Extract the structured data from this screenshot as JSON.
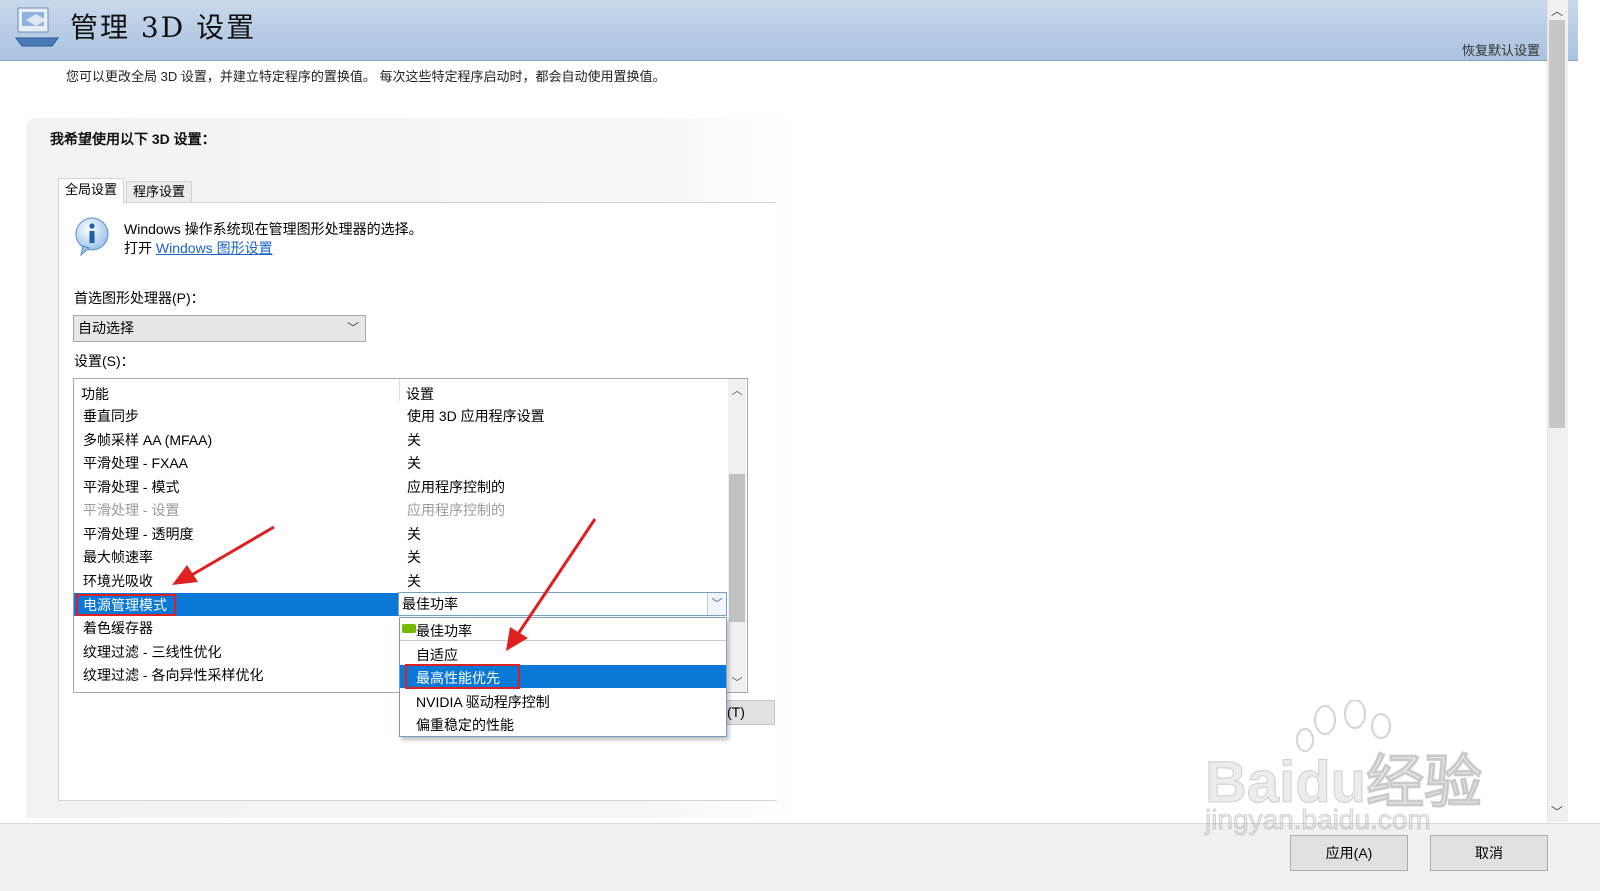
{
  "header": {
    "title": "管理 3D 设置",
    "restore_defaults": "恢复默认设置"
  },
  "description": "您可以更改全局 3D 设置，并建立特定程序的置换值。 每次这些特定程序启动时，都会自动使用置换值。",
  "panel": {
    "heading": "我希望使用以下 3D 设置：",
    "tabs": [
      "全局设置",
      "程序设置"
    ],
    "info_line1": "Windows 操作系统现在管理图形处理器的选择。",
    "info_open": "打开",
    "info_link": "Windows 图形设置",
    "gpu_label": "首选图形处理器(P)：",
    "gpu_value": "自动选择",
    "settings_label": "设置(S)："
  },
  "table": {
    "headers": [
      "功能",
      "设置"
    ],
    "rows": [
      {
        "feature": "垂直同步",
        "setting": "使用 3D 应用程序设置"
      },
      {
        "feature": "多帧采样 AA (MFAA)",
        "setting": "关"
      },
      {
        "feature": "平滑处理 - FXAA",
        "setting": "关"
      },
      {
        "feature": "平滑处理 - 模式",
        "setting": "应用程序控制的"
      },
      {
        "feature": "平滑处理 - 设置",
        "setting": "应用程序控制的"
      },
      {
        "feature": "平滑处理 - 透明度",
        "setting": "关"
      },
      {
        "feature": "最大帧速率",
        "setting": "关"
      },
      {
        "feature": "环境光吸收",
        "setting": "关"
      },
      {
        "feature": "电源管理模式",
        "setting": "最佳功率"
      },
      {
        "feature": "着色缓存器",
        "setting": ""
      },
      {
        "feature": "纹理过滤 - 三线性优化",
        "setting": ""
      },
      {
        "feature": "纹理过滤 - 各向异性采样优化",
        "setting": ""
      }
    ],
    "dropdown_options": [
      "最佳功率",
      "自适应",
      "最高性能优先",
      "NVIDIA 驱动程序控制",
      "偏重稳定的性能"
    ],
    "partial_button": "(T)"
  },
  "footer": {
    "apply": "应用(A)",
    "cancel": "取消"
  },
  "watermark": {
    "line1": "Baidu经验",
    "line2": "jingyan.baidu.com"
  },
  "colors": {
    "selection": "#0a78d7",
    "annotation": "#e02020",
    "link": "#1a64c8",
    "header": "#b7cce6"
  }
}
